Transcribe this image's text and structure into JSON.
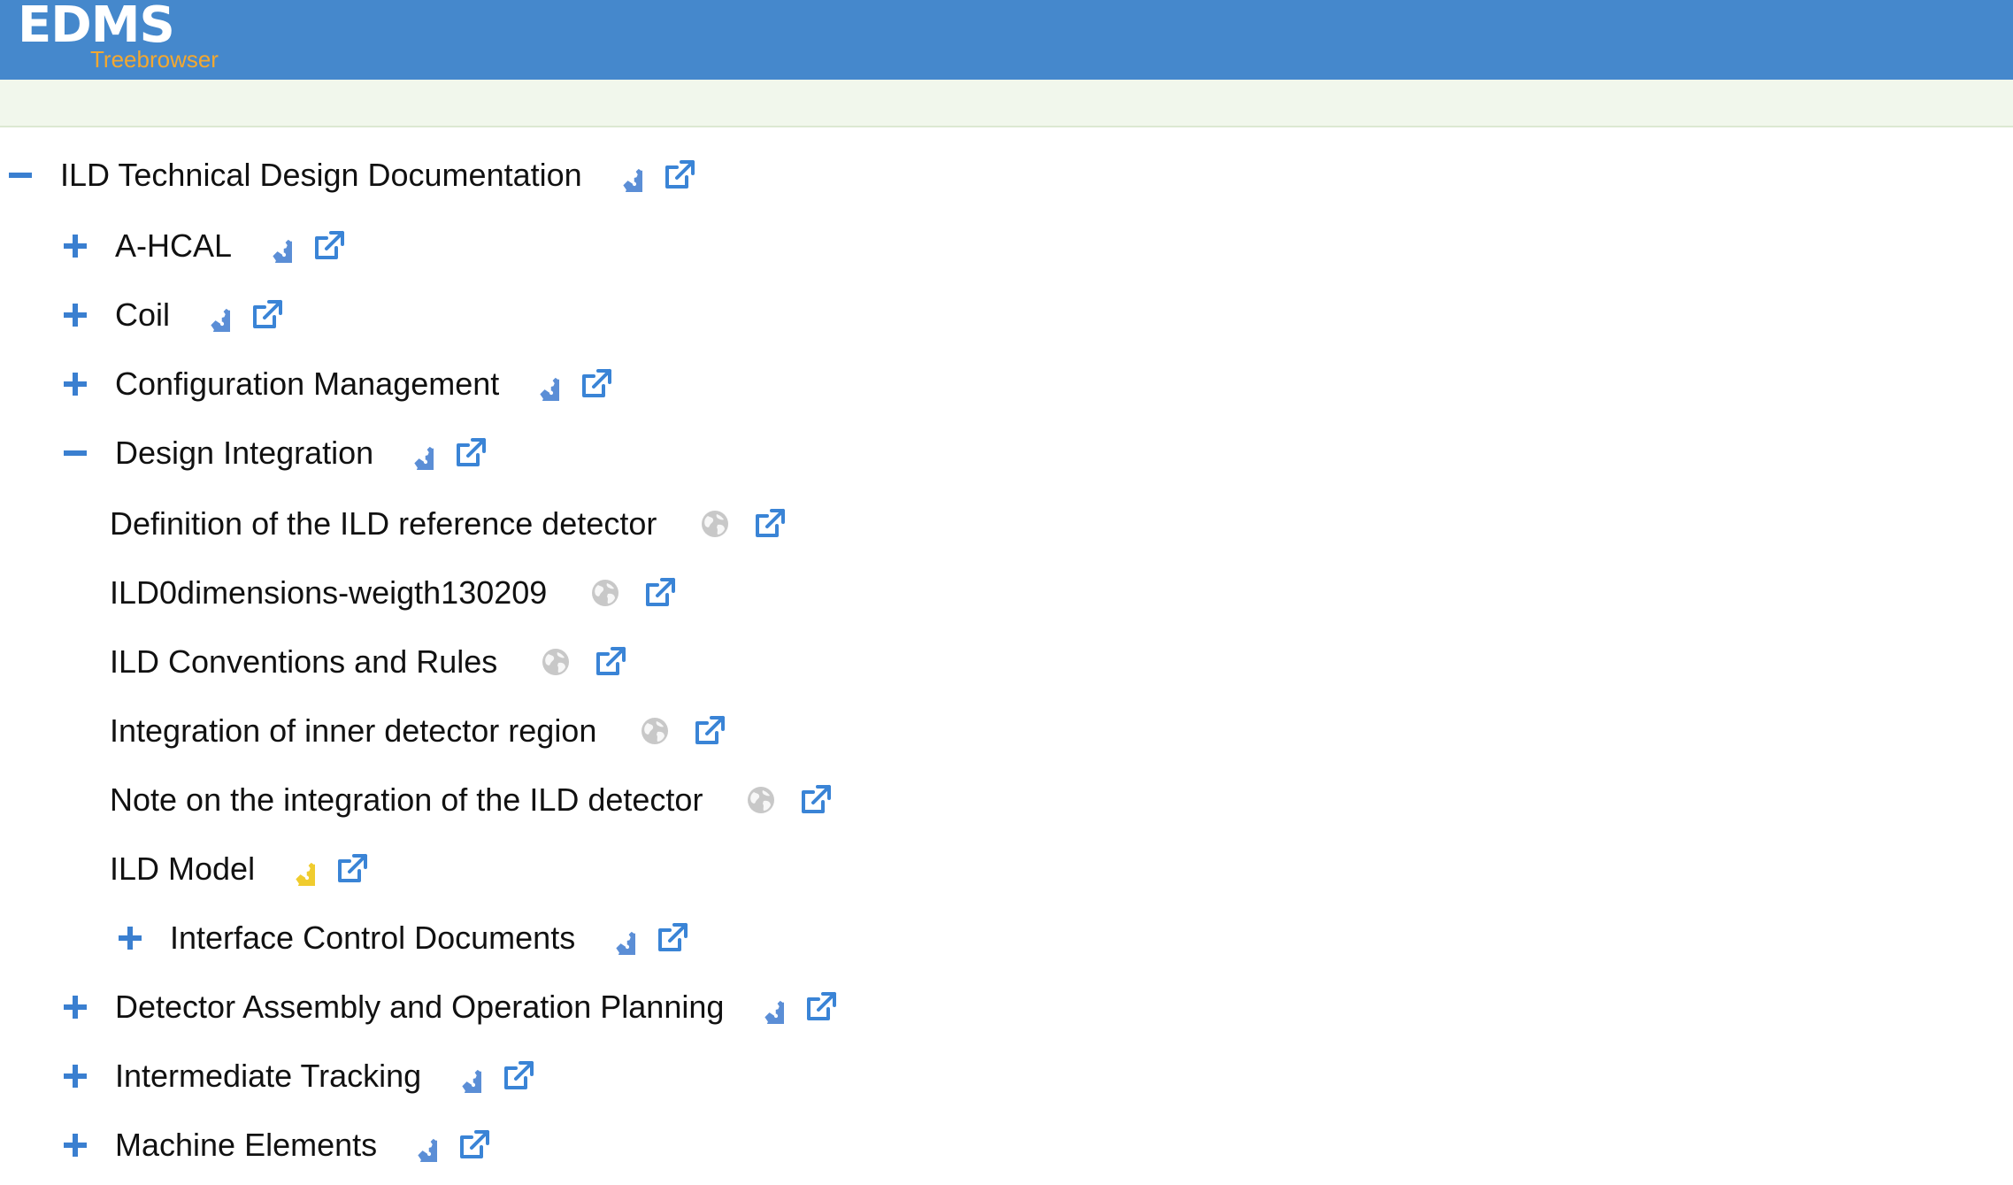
{
  "header": {
    "logo": "EDMS",
    "subtitle": "Treebrowser",
    "background": "#4588cc",
    "subtitle_color": "#f3a830"
  },
  "colors": {
    "toggle": "#3a7fd0",
    "gear_blue": "#5b8ed6",
    "gear_yellow": "#f0cc2e",
    "external_link": "#3a84d6",
    "globe": "#c8c8c8"
  },
  "tree": {
    "root": {
      "label": "ILD Technical Design Documentation",
      "toggle": "collapse",
      "icons": [
        "gears-icon",
        "external-link-icon"
      ]
    },
    "children": [
      {
        "label": "A-HCAL",
        "toggle": "expand",
        "icons": [
          "gears-icon",
          "external-link-icon"
        ]
      },
      {
        "label": "Coil",
        "toggle": "expand",
        "icons": [
          "gears-icon",
          "external-link-icon"
        ]
      },
      {
        "label": "Configuration Management",
        "toggle": "expand",
        "icons": [
          "gears-icon",
          "external-link-icon"
        ]
      },
      {
        "label": "Design Integration",
        "toggle": "collapse",
        "icons": [
          "gears-icon",
          "external-link-icon"
        ]
      },
      {
        "label": "Detector Assembly and Operation Planning",
        "toggle": "expand",
        "icons": [
          "gears-icon",
          "external-link-icon"
        ]
      },
      {
        "label": "Intermediate Tracking",
        "toggle": "expand",
        "icons": [
          "gears-icon",
          "external-link-icon"
        ]
      },
      {
        "label": "Machine Elements",
        "toggle": "expand",
        "icons": [
          "gears-icon",
          "external-link-icon"
        ]
      }
    ],
    "design_integration_children": [
      {
        "label": "Definition of the ILD reference detector",
        "icons": [
          "globe-icon",
          "external-link-icon"
        ]
      },
      {
        "label": "ILD0dimensions-weigth130209",
        "icons": [
          "globe-icon",
          "external-link-icon"
        ]
      },
      {
        "label": "ILD Conventions and Rules",
        "icons": [
          "globe-icon",
          "external-link-icon"
        ]
      },
      {
        "label": "Integration of inner detector region",
        "icons": [
          "globe-icon",
          "external-link-icon"
        ]
      },
      {
        "label": "Note on the integration of the ILD detector",
        "icons": [
          "globe-icon",
          "external-link-icon"
        ]
      },
      {
        "label": "ILD Model",
        "icons": [
          "gears-yellow-icon",
          "external-link-icon"
        ]
      },
      {
        "label": "Interface Control Documents",
        "toggle": "expand",
        "icons": [
          "gears-icon",
          "external-link-icon"
        ]
      }
    ]
  }
}
